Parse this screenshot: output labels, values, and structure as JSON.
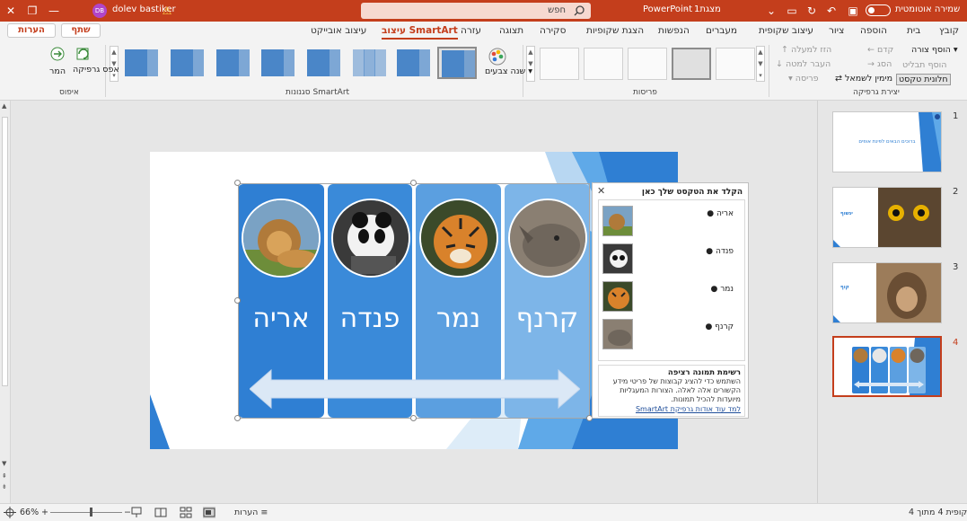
{
  "titlebar": {
    "autosave_label": "שמירה אוטומטית",
    "doc_title": "מצגת1",
    "app_name": "PowerPoint",
    "separator": "-",
    "search_placeholder": "חפש",
    "user_name": "dolev bastiker",
    "user_initials": "DB"
  },
  "tabs": [
    {
      "label": "קובץ"
    },
    {
      "label": "בית"
    },
    {
      "label": "הוספה"
    },
    {
      "label": "ציור"
    },
    {
      "label": "עיצוב שקופית"
    },
    {
      "label": "מעברים"
    },
    {
      "label": "הנפשות"
    },
    {
      "label": "הצגת שקופיות"
    },
    {
      "label": "סקירה"
    },
    {
      "label": "תצוגה"
    },
    {
      "label": "עזרה"
    },
    {
      "label": "עיצוב SmartArt",
      "active": true
    },
    {
      "label": "עיצוב אובייקט"
    }
  ],
  "share_label": "שתף",
  "comments_label": "הערות",
  "ribbon": {
    "create_graphic": {
      "label": "יצירת גרפיקה",
      "add_shape": "הוסף צורה",
      "add_bullet": "הוסף תבליט",
      "text_pane": "חלונית טקסט",
      "promote": "קדם",
      "demote": "הסג",
      "right_to_left": "מימין לשמאל",
      "move_up": "הזז למעלה",
      "move_down": "העבר למטה",
      "layout": "פריסה"
    },
    "layouts_label": "פריסות",
    "change_colors": "שנה צבעים",
    "styles_label": "סגנונות SmartArt",
    "reset": {
      "label": "איפוס",
      "reset_graphic": "אפס גרפיקה",
      "convert": "המר"
    }
  },
  "slide": {
    "animals": [
      {
        "name": "אריה",
        "photo": "lion-photo"
      },
      {
        "name": "פנדה",
        "photo": "panda-photo"
      },
      {
        "name": "נמר",
        "photo": "tiger-photo"
      },
      {
        "name": "קרנף",
        "photo": "rhino-photo"
      }
    ]
  },
  "text_pane": {
    "title": "הקלד את הטקסט שלך כאן",
    "items": [
      "אריה",
      "פנדה",
      "נמר",
      "קרנף"
    ],
    "desc_title": "רשימת תמונה רציפה",
    "desc_body": "השתמש כדי להציג קבוצות של פריטי מידע הקשורים אלה לאלה. הצורות המעגליות מיועדות להכיל תמונות.",
    "learn_more": "למד עוד אודות גרפיקת SmartArt"
  },
  "thumbnails": [
    {
      "num": "1",
      "title": "ברוכים הבאים לפינת אופים"
    },
    {
      "num": "2",
      "title": "ינשוף"
    },
    {
      "num": "3",
      "title": "קוף"
    },
    {
      "num": "4",
      "active": true
    }
  ],
  "status": {
    "slide_info": "שקופית 4 מתוך 4",
    "notes": "הערות",
    "zoom": "66%"
  },
  "colors": {
    "accent": "#c43e1c",
    "panel_1": "#2f7fd3",
    "panel_2": "#3a8ad9",
    "panel_3": "#5b9fe0",
    "panel_4": "#7db5e8"
  }
}
